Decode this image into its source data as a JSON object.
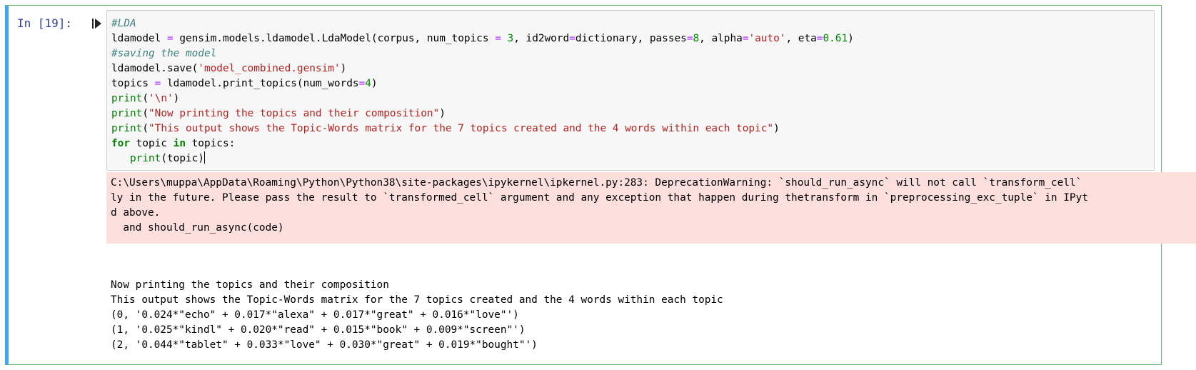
{
  "cell": {
    "prompt": "In [19]:",
    "code_lines": [
      {
        "parts": [
          {
            "c": "cm",
            "t": "#LDA"
          }
        ]
      },
      {
        "parts": [
          {
            "c": "",
            "t": "ldamodel "
          },
          {
            "c": "op",
            "t": "="
          },
          {
            "c": "",
            "t": " gensim.models.ldamodel.LdaModel(corpus, num_topics "
          },
          {
            "c": "op",
            "t": "="
          },
          {
            "c": "",
            "t": " "
          },
          {
            "c": "nu",
            "t": "3"
          },
          {
            "c": "",
            "t": ", id2word"
          },
          {
            "c": "op",
            "t": "="
          },
          {
            "c": "",
            "t": "dictionary, passes"
          },
          {
            "c": "op",
            "t": "="
          },
          {
            "c": "nu",
            "t": "8"
          },
          {
            "c": "",
            "t": ", alpha"
          },
          {
            "c": "op",
            "t": "="
          },
          {
            "c": "st",
            "t": "'auto'"
          },
          {
            "c": "",
            "t": ", eta"
          },
          {
            "c": "op",
            "t": "="
          },
          {
            "c": "nu",
            "t": "0.61"
          },
          {
            "c": "",
            "t": ")"
          }
        ]
      },
      {
        "parts": [
          {
            "c": "cm",
            "t": "#saving the model"
          }
        ]
      },
      {
        "parts": [
          {
            "c": "",
            "t": "ldamodel.save("
          },
          {
            "c": "st",
            "t": "'model_combined.gensim'"
          },
          {
            "c": "",
            "t": ")"
          }
        ]
      },
      {
        "parts": [
          {
            "c": "",
            "t": "topics "
          },
          {
            "c": "op",
            "t": "="
          },
          {
            "c": "",
            "t": " ldamodel.print_topics(num_words"
          },
          {
            "c": "op",
            "t": "="
          },
          {
            "c": "nu",
            "t": "4"
          },
          {
            "c": "",
            "t": ")"
          }
        ]
      },
      {
        "parts": [
          {
            "c": "bi",
            "t": "print"
          },
          {
            "c": "",
            "t": "("
          },
          {
            "c": "st",
            "t": "'\\n'"
          },
          {
            "c": "",
            "t": ")"
          }
        ]
      },
      {
        "parts": [
          {
            "c": "bi",
            "t": "print"
          },
          {
            "c": "",
            "t": "("
          },
          {
            "c": "st",
            "t": "\"Now printing the topics and their composition\""
          },
          {
            "c": "",
            "t": ")"
          }
        ]
      },
      {
        "parts": [
          {
            "c": "bi",
            "t": "print"
          },
          {
            "c": "",
            "t": "("
          },
          {
            "c": "st",
            "t": "\"This output shows the Topic-Words matrix for the 7 topics created and the 4 words within each topic\""
          },
          {
            "c": "",
            "t": ")"
          }
        ]
      },
      {
        "parts": [
          {
            "c": "kw",
            "t": "for"
          },
          {
            "c": "",
            "t": " topic "
          },
          {
            "c": "kw",
            "t": "in"
          },
          {
            "c": "",
            "t": " topics:"
          }
        ]
      },
      {
        "parts": [
          {
            "c": "",
            "t": "   "
          },
          {
            "c": "bi",
            "t": "print"
          },
          {
            "c": "",
            "t": "(topic)"
          }
        ]
      }
    ],
    "stderr": "C:\\Users\\muppa\\AppData\\Roaming\\Python\\Python38\\site-packages\\ipykernel\\ipkernel.py:283: DeprecationWarning: `should_run_async` will not call `transform_cell`\nly in the future. Please pass the result to `transformed_cell` argument and any exception that happen during thetransform in `preprocessing_exc_tuple` in IPyt\nd above.\n  and should_run_async(code)",
    "stdout": "Now printing the topics and their composition\nThis output shows the Topic-Words matrix for the 7 topics created and the 4 words within each topic\n(0, '0.024*\"echo\" + 0.017*\"alexa\" + 0.017*\"great\" + 0.016*\"love\"')\n(1, '0.025*\"kindl\" + 0.020*\"read\" + 0.015*\"book\" + 0.009*\"screen\"')\n(2, '0.044*\"tablet\" + 0.033*\"love\" + 0.030*\"great\" + 0.019*\"bought\"')"
  },
  "icons": {
    "run": "run-cell-icon"
  },
  "colors": {
    "prompt": "#303f9f",
    "cell_border": "#66bb6a",
    "stderr_bg": "#fddfdd"
  }
}
